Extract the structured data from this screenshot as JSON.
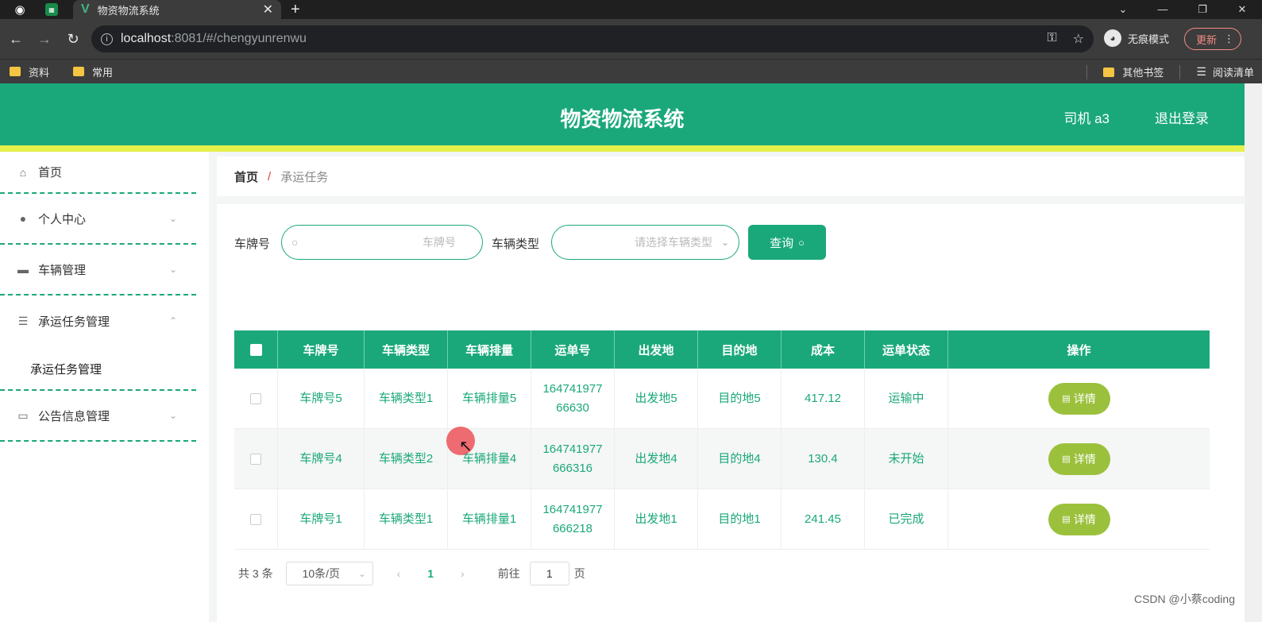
{
  "browser": {
    "tab_title": "物资物流系统",
    "url_host": "localhost",
    "url_rest": ":8081/#/chengyunrenwu",
    "incognito_label": "无痕模式",
    "update_label": "更新",
    "bookmarks": [
      "资料",
      "常用"
    ],
    "bookmarks_right": [
      "其他书签",
      "阅读清单"
    ]
  },
  "header": {
    "title": "物资物流系统",
    "user": "司机 a3",
    "logout": "退出登录"
  },
  "sidebar": {
    "items": [
      {
        "label": "首页",
        "icon": "home-icon"
      },
      {
        "label": "个人中心",
        "icon": "user-icon"
      },
      {
        "label": "车辆管理",
        "icon": "monitor-icon"
      },
      {
        "label": "承运任务管理",
        "icon": "list-icon"
      },
      {
        "label": "公告信息管理",
        "icon": "chat-icon"
      }
    ],
    "sub_item": "承运任务管理"
  },
  "breadcrumb": {
    "home": "首页",
    "sep": "/",
    "current": "承运任务"
  },
  "filters": {
    "plate_label": "车牌号",
    "plate_placeholder": "车牌号",
    "type_label": "车辆类型",
    "type_placeholder": "请选择车辆类型",
    "query_label": "查询"
  },
  "table": {
    "columns": [
      "车牌号",
      "车辆类型",
      "车辆排量",
      "运单号",
      "出发地",
      "目的地",
      "成本",
      "运单状态",
      "操作"
    ],
    "rows": [
      {
        "plate": "车牌号5",
        "type": "车辆类型1",
        "disp": "车辆排量5",
        "order_a": "164741977",
        "order_b": "66630",
        "from": "出发地5",
        "to": "目的地5",
        "cost": "417.12",
        "status": "运输中"
      },
      {
        "plate": "车牌号4",
        "type": "车辆类型2",
        "disp": "车辆排量4",
        "order_a": "164741977",
        "order_b": "666316",
        "from": "出发地4",
        "to": "目的地4",
        "cost": "130.4",
        "status": "未开始"
      },
      {
        "plate": "车牌号1",
        "type": "车辆类型1",
        "disp": "车辆排量1",
        "order_a": "164741977",
        "order_b": "666218",
        "from": "出发地1",
        "to": "目的地1",
        "cost": "241.45",
        "status": "已完成"
      }
    ],
    "detail_label": "详情"
  },
  "pagination": {
    "total": "共 3 条",
    "page_size": "10条/页",
    "current": "1",
    "goto_label": "前往",
    "goto_value": "1",
    "page_suffix": "页"
  },
  "watermark": "CSDN @小蔡coding",
  "colors": {
    "primary": "#1aa87a",
    "stripe": "#e6f04a",
    "detail": "#9bc13c"
  }
}
